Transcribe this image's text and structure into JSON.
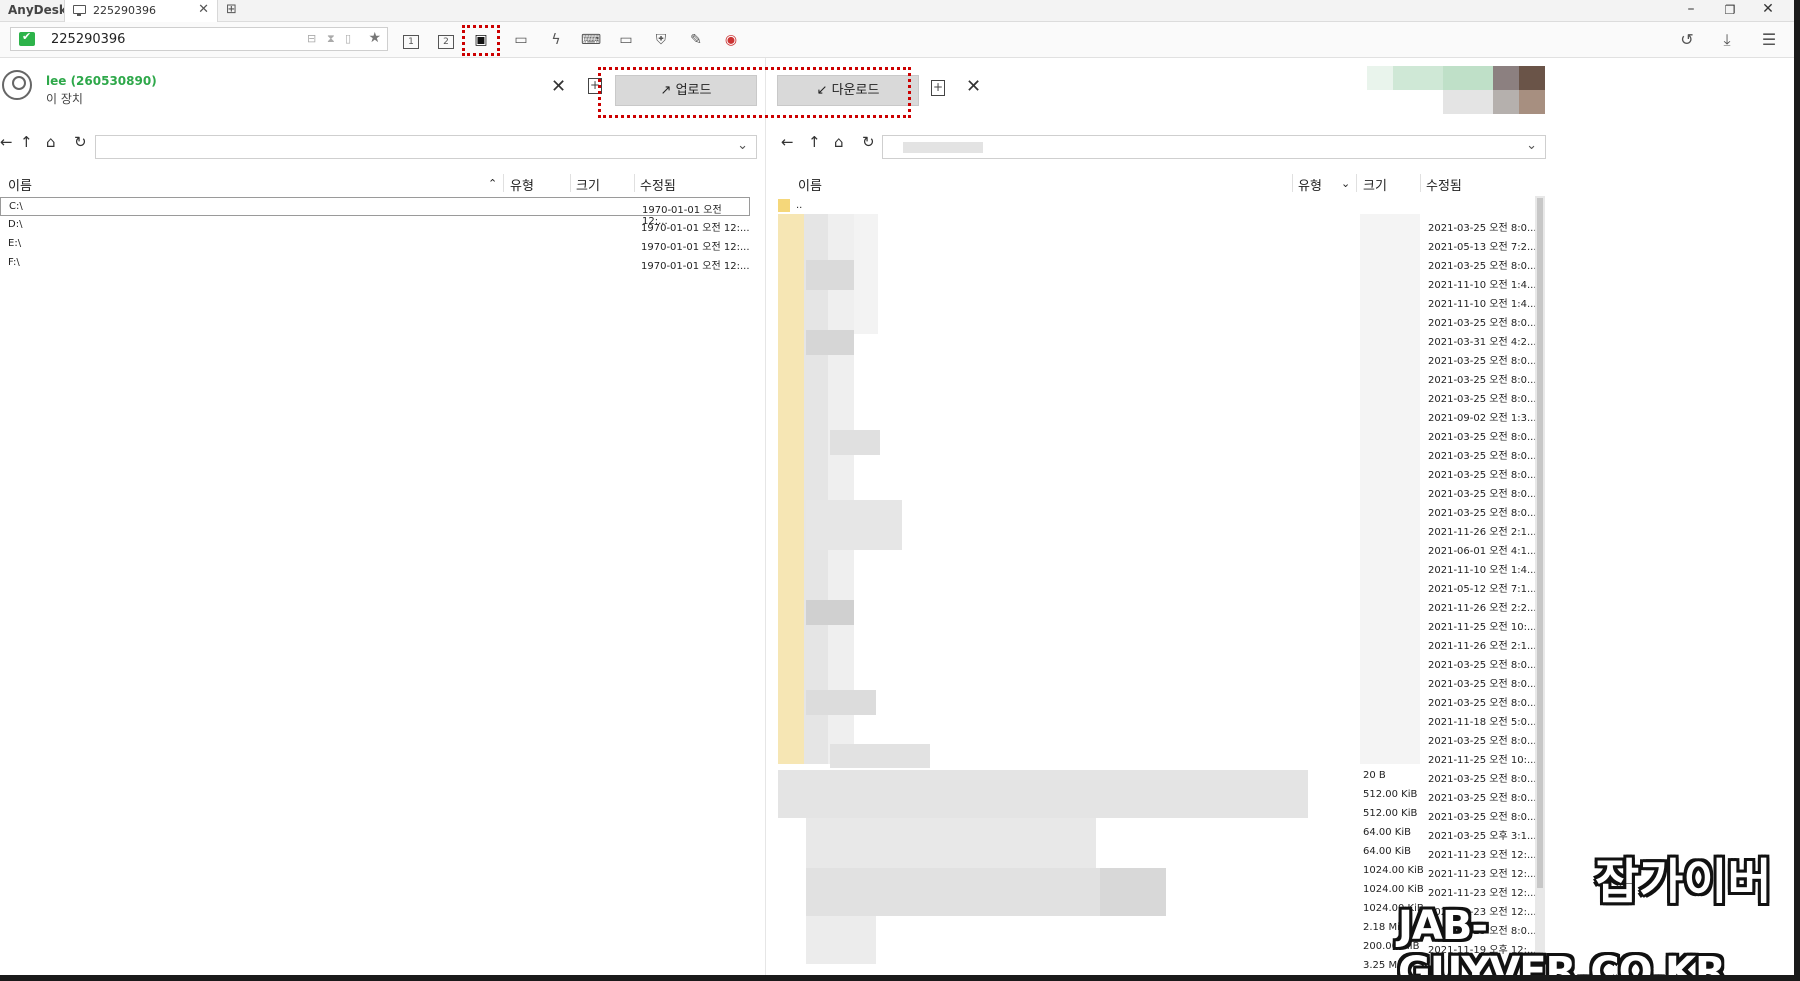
{
  "app": {
    "brand": "AnyDesk",
    "tab_label": "225290396"
  },
  "toolbar": {
    "address": "225290396",
    "tools": [
      "monitor-1-icon",
      "monitor-2-icon",
      "file-transfer-icon",
      "chat-icon",
      "action-icon",
      "keyboard-icon",
      "display-icon",
      "permissions-icon",
      "whiteboard-icon",
      "record-icon"
    ],
    "monitor_1": "1",
    "monitor_2": "2"
  },
  "local": {
    "user_name": "lee (260530890)",
    "device_label": "이 장치",
    "columns": {
      "name": "이름",
      "type": "유형",
      "size": "크기",
      "modified": "수정됨"
    },
    "rows": [
      {
        "name": "C:\\",
        "modified": "1970-01-01 오전 12:..."
      },
      {
        "name": "D:\\",
        "modified": "1970-01-01 오전 12:..."
      },
      {
        "name": "E:\\",
        "modified": "1970-01-01 오전 12:..."
      },
      {
        "name": "F:\\",
        "modified": "1970-01-01 오전 12:..."
      }
    ]
  },
  "transfer": {
    "upload": "업로드",
    "download": "다운로드"
  },
  "remote": {
    "columns": {
      "name": "이름",
      "type": "유형",
      "size": "크기",
      "modified": "수정됨"
    },
    "parent": "..",
    "dates": [
      "2021-03-25 오전 8:0...",
      "2021-05-13 오전 7:2...",
      "2021-03-25 오전 8:0...",
      "2021-11-10 오전 1:4...",
      "2021-11-10 오전 1:4...",
      "2021-03-25 오전 8:0...",
      "2021-03-31 오전 4:2...",
      "2021-03-25 오전 8:0...",
      "2021-03-25 오전 8:0...",
      "2021-03-25 오전 8:0...",
      "2021-09-02 오전 1:3...",
      "2021-03-25 오전 8:0...",
      "2021-03-25 오전 8:0...",
      "2021-03-25 오전 8:0...",
      "2021-03-25 오전 8:0...",
      "2021-03-25 오전 8:0...",
      "2021-11-26 오전 2:1...",
      "2021-06-01 오전 4:1...",
      "2021-11-10 오전 1:4...",
      "2021-05-12 오전 7:1...",
      "2021-11-26 오전 2:2...",
      "2021-11-25 오전 10:...",
      "2021-11-26 오전 2:1...",
      "2021-03-25 오전 8:0...",
      "2021-03-25 오전 8:0...",
      "2021-03-25 오전 8:0...",
      "2021-11-18 오전 5:0...",
      "2021-03-25 오전 8:0...",
      "2021-11-25 오전 10:...",
      "2021-03-25 오전 8:0...",
      "2021-03-25 오전 8:0...",
      "2021-03-25 오전 8:0...",
      "2021-03-25 오후 3:1...",
      "2021-11-23 오전 12:...",
      "2021-11-23 오전 12:...",
      "2021-11-23 오전 12:...",
      "2021-11-23 오전 12:...",
      "2021-03-25 오전 8:0...",
      "2021-11-19 오후 12:..."
    ],
    "sizes": [
      "20 B",
      "512.00 KiB",
      "512.00 KiB",
      "64.00 KiB",
      "64.00 KiB",
      "1024.00 KiB",
      "1024.00 KiB",
      "1024.00 KiB",
      "2.18 MiB",
      "200.00 MiB",
      "3.25 MiB"
    ]
  },
  "watermark": {
    "korean": "잡가이버",
    "english": "JAB-GUYVER.CO.KR"
  }
}
